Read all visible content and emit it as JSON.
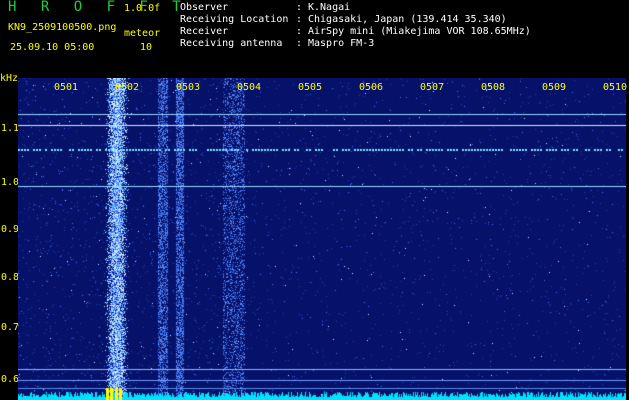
{
  "header": {
    "app_title": "H R O F F T",
    "app_version": "1.0.0f",
    "file_name": "KN9_2509100500.png",
    "timestamp": "25.09.10 05:00",
    "meteor_label": "meteor",
    "meteor_count": "10"
  },
  "station_info": [
    {
      "label": "Observer",
      "value": "K.Nagai"
    },
    {
      "label": "Receiving Location",
      "value": "Chigasaki, Japan (139.414 35.340)"
    },
    {
      "label": "Receiver",
      "value": "AirSpy mini (Miakejima VOR 108.65MHz)"
    },
    {
      "label": "Receiving antenna",
      "value": "Maspro FM-3"
    }
  ],
  "spectrogram": {
    "freq_unit": "kHz",
    "y_ticks": [
      "1.1",
      "1.0",
      "0.9",
      "0.8",
      "0.7",
      "0.6"
    ],
    "x_ticks": [
      "0501",
      "0502",
      "0503",
      "0504",
      "0505",
      "0506",
      "0507",
      "0508",
      "0509",
      "0510"
    ],
    "colors": {
      "background": "#06126a",
      "noise_speck": "#3c6cff",
      "tick_color": "#ffff00",
      "carrier_line": "#7fe6ff",
      "bottom_noise": "#00e0ff",
      "signal_bar": "#ffff00"
    }
  }
}
